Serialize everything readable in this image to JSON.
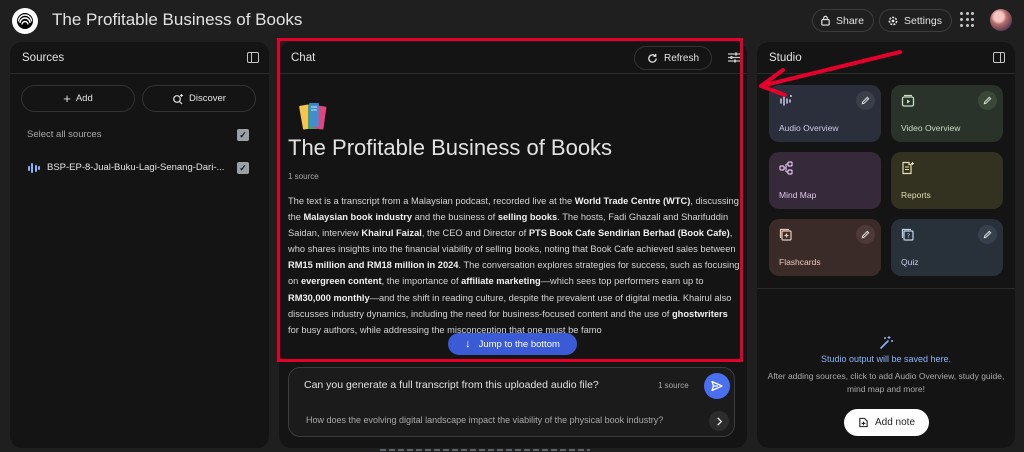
{
  "header": {
    "title": "The Profitable Business of Books",
    "share_label": "Share",
    "settings_label": "Settings"
  },
  "sources": {
    "title": "Sources",
    "add_label": "Add",
    "discover_label": "Discover",
    "select_all_label": "Select all sources",
    "items": [
      {
        "label": "BSP-EP-8-Jual-Buku-Lagi-Senang-Dari-..."
      }
    ]
  },
  "chat": {
    "title": "Chat",
    "refresh_label": "Refresh",
    "notebook_title": "The Profitable Business of Books",
    "source_count": "1 source",
    "summary_segments": [
      {
        "text": "The text is a transcript from a Malaysian podcast, recorded live at the ",
        "bold": false
      },
      {
        "text": "World Trade Centre (WTC)",
        "bold": true
      },
      {
        "text": ", discussing the ",
        "bold": false
      },
      {
        "text": "Malaysian book industry",
        "bold": true
      },
      {
        "text": " and the business of ",
        "bold": false
      },
      {
        "text": "selling books",
        "bold": true
      },
      {
        "text": ". The hosts, Fadi Ghazali and Sharifuddin Saidan, interview ",
        "bold": false
      },
      {
        "text": "Khairul Faizal",
        "bold": true
      },
      {
        "text": ", the CEO and Director of ",
        "bold": false
      },
      {
        "text": "PTS Book Cafe Sendirian Berhad (Book Cafe)",
        "bold": true
      },
      {
        "text": ", who shares insights into the financial viability of selling books, noting that Book Cafe achieved sales between ",
        "bold": false
      },
      {
        "text": "RM15 million and RM18 million in 2024",
        "bold": true
      },
      {
        "text": ". The conversation explores strategies for success, such as focusing on ",
        "bold": false
      },
      {
        "text": "evergreen content",
        "bold": true
      },
      {
        "text": ", the importance of ",
        "bold": false
      },
      {
        "text": "affiliate marketing",
        "bold": true
      },
      {
        "text": "—which sees top performers earn up to ",
        "bold": false
      },
      {
        "text": "RM30,000 monthly",
        "bold": true
      },
      {
        "text": "—and the shift in reading culture, despite the prevalent use of digital media. Khairul also discusses industry dynamics, including the need for business-focused content and the use of ",
        "bold": false
      },
      {
        "text": "ghostwriters",
        "bold": true
      },
      {
        "text": " for busy authors, while addressing the misconception that one must be famo",
        "bold": false
      }
    ],
    "jump_label": "Jump to the bottom",
    "input_value": "Can you generate a full transcript from this uploaded audio file?",
    "input_source_count": "1 source",
    "suggestion": "How does the evolving digital landscape impact the viability of the physical book industry?"
  },
  "studio": {
    "title": "Studio",
    "tiles": {
      "audio": "Audio Overview",
      "video": "Video Overview",
      "mind": "Mind Map",
      "reports": "Reports",
      "flash": "Flashcards",
      "quiz": "Quiz"
    },
    "output_title": "Studio output will be saved here.",
    "output_desc": "After adding sources, click to add Audio Overview, study guide, mind map and more!",
    "add_note_label": "Add note"
  },
  "colors": {
    "background": "#1f1f1f",
    "panel": "#141414",
    "accent": "#4a6ff0",
    "highlight": "#e4002b",
    "link": "#8ab4f8"
  },
  "icons": [
    "notebook-logo-icon",
    "lock-icon",
    "gear-icon",
    "apps-grid-icon",
    "panel-toggle-icon",
    "plus-icon",
    "discover-icon",
    "checkbox-icon",
    "audio-source-icon",
    "refresh-icon",
    "tune-icon",
    "book-stack-icon",
    "arrow-down-icon",
    "send-icon",
    "chevron-right-icon",
    "edit-pencil-icon",
    "waveform-icon",
    "video-icon",
    "mind-map-icon",
    "reports-icon",
    "flashcards-icon",
    "quiz-icon",
    "magic-wand-icon",
    "note-add-icon"
  ]
}
